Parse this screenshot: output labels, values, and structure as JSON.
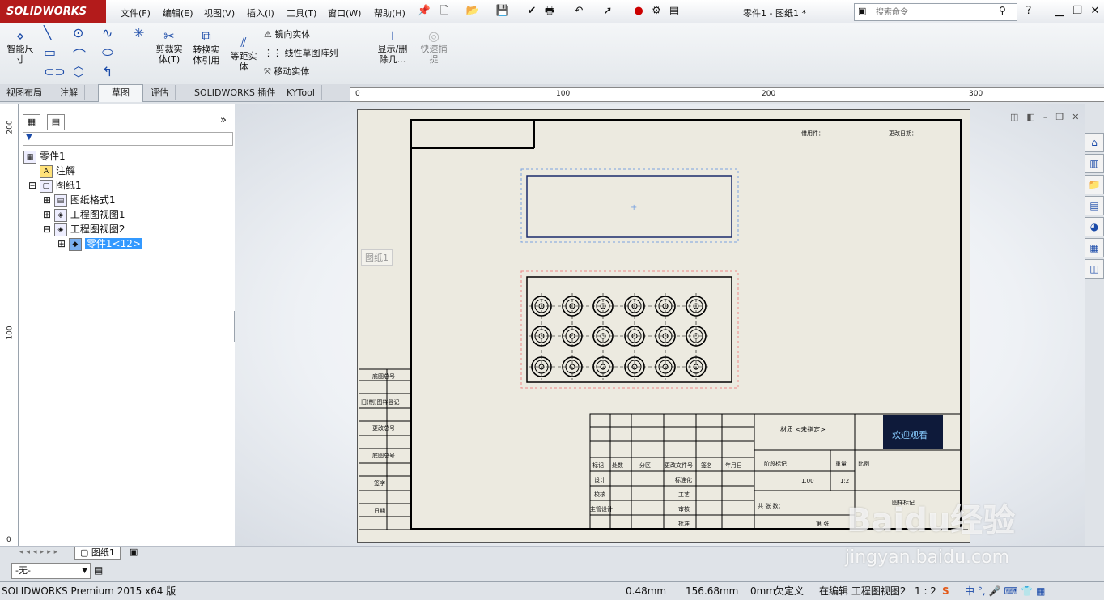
{
  "app": {
    "logo": "SOLIDWORKS",
    "title": "零件1 - 图纸1 *"
  },
  "menu": [
    "文件(F)",
    "编辑(E)",
    "视图(V)",
    "插入(I)",
    "工具(T)",
    "窗口(W)",
    "帮助(H)"
  ],
  "search": {
    "placeholder": "搜索命令"
  },
  "ribbon": {
    "smart_dim": "智能尺寸",
    "trim": "剪裁实体(T)",
    "convert": "转换实体引用",
    "offset": "等距实体",
    "mirror": "镜向实体",
    "linear_pattern": "线性草图阵列",
    "move": "移动实体",
    "show_delete": "显示/删除几...",
    "quick_snap": "快速捕捉"
  },
  "tabs": [
    "视图布局",
    "注解",
    "草图",
    "评估",
    "SOLIDWORKS 插件",
    "KYTool"
  ],
  "active_tab": "草图",
  "ruler_top": [
    "0",
    "100",
    "200",
    "300"
  ],
  "ruler_left": [
    "200",
    "100",
    "0"
  ],
  "tree": {
    "items": [
      {
        "label": "零件1",
        "icon": "drawing-icon"
      },
      {
        "label": "注解",
        "icon": "annotation-icon"
      },
      {
        "label": "图纸1",
        "icon": "sheet-icon"
      },
      {
        "label": "图纸格式1",
        "icon": "sheet-format-icon"
      },
      {
        "label": "工程图视图1",
        "icon": "drawing-view-icon"
      },
      {
        "label": "工程图视图2",
        "icon": "drawing-view-icon"
      },
      {
        "label": "零件1<12>",
        "icon": "part-icon"
      }
    ]
  },
  "sheet": {
    "label": "图纸1",
    "top_labels": [
      "借用件：",
      "更改日期："
    ],
    "left_labels": [
      "底图总号",
      "旧(制)图样登记",
      "更改总号",
      "底图总号",
      "签字",
      "日期"
    ],
    "title_block": {
      "material": "材质 <未指定>",
      "mark_row": [
        "标记",
        "处数",
        "分区",
        "更改文件号",
        "签名",
        "年月日"
      ],
      "rows": [
        "设计",
        "校核",
        "主管设计"
      ],
      "rows2": [
        "标准化",
        "工艺",
        "审核",
        "批准"
      ],
      "stage": "阶段标记",
      "weight": "重量",
      "scale": "比例",
      "weight_val": "1.00",
      "scale_val": "1:2",
      "sheets": "共 张 数：",
      "sheet_no": "第 张",
      "drawing_no": "图样标记",
      "logo_text": "欢迎观看"
    }
  },
  "bottom": {
    "sheet_tab": "图纸1",
    "dropdown": "-无-"
  },
  "status": {
    "product": "SOLIDWORKS Premium 2015 x64 版",
    "x": "0.48mm",
    "y": "156.68mm",
    "z": "0mm",
    "state": "欠定义",
    "editing": "在编辑 工程图视图2",
    "scale": "1 : 2"
  },
  "watermark": {
    "brand": "Baidu经验",
    "url": "jingyan.baidu.com"
  },
  "colors": {
    "accent": "#1a4aa8",
    "logo": "#b31b1b",
    "sheet": "#eceae0"
  }
}
